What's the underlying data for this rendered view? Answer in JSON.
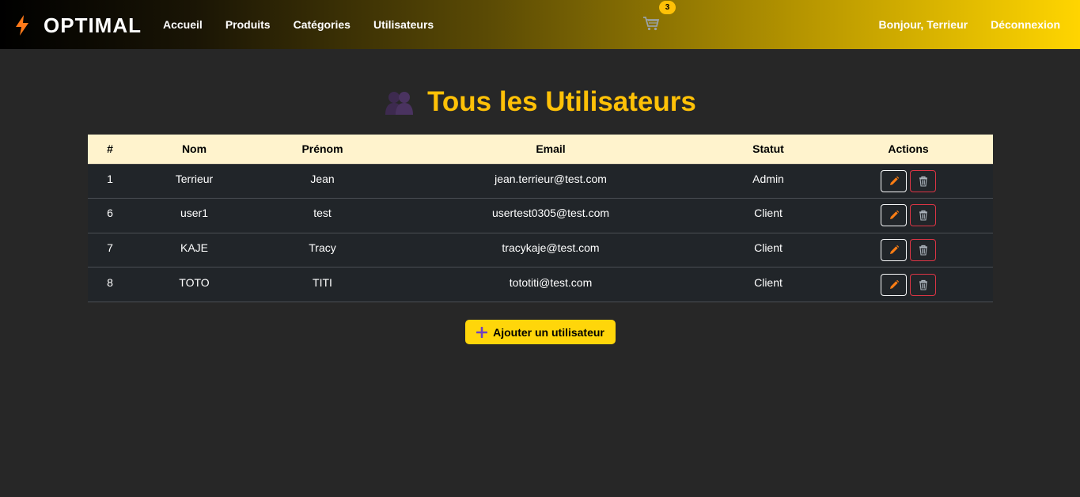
{
  "navbar": {
    "brand": "OPTIMAL",
    "brand_icon": "lightning-icon",
    "links": [
      "Accueil",
      "Produits",
      "Catégories",
      "Utilisateurs"
    ],
    "cart_icon": "cart-icon",
    "cart_count": "3",
    "greeting": "Bonjour, Terrieur",
    "logout": "Déconnexion"
  },
  "page": {
    "title": "Tous les Utilisateurs",
    "title_icon": "users-icon"
  },
  "table": {
    "headers": [
      "#",
      "Nom",
      "Prénom",
      "Email",
      "Statut",
      "Actions"
    ],
    "rows": [
      {
        "id": "1",
        "nom": "Terrieur",
        "prenom": "Jean",
        "email": "jean.terrieur@test.com",
        "statut": "Admin"
      },
      {
        "id": "6",
        "nom": "user1",
        "prenom": "test",
        "email": "usertest0305@test.com",
        "statut": "Client"
      },
      {
        "id": "7",
        "nom": "KAJE",
        "prenom": "Tracy",
        "email": "tracykaje@test.com",
        "statut": "Client"
      },
      {
        "id": "8",
        "nom": "TOTO",
        "prenom": "TITI",
        "email": "tototiti@test.com",
        "statut": "Client"
      }
    ],
    "edit_icon": "pencil-icon",
    "delete_icon": "trash-icon"
  },
  "add_button": {
    "label": "Ajouter un utilisateur",
    "icon": "plus-icon"
  },
  "colors": {
    "background": "#272727",
    "accent": "#ffc107",
    "table_header": "#fff3cd",
    "table_row": "#212529",
    "danger": "#dc3545"
  }
}
